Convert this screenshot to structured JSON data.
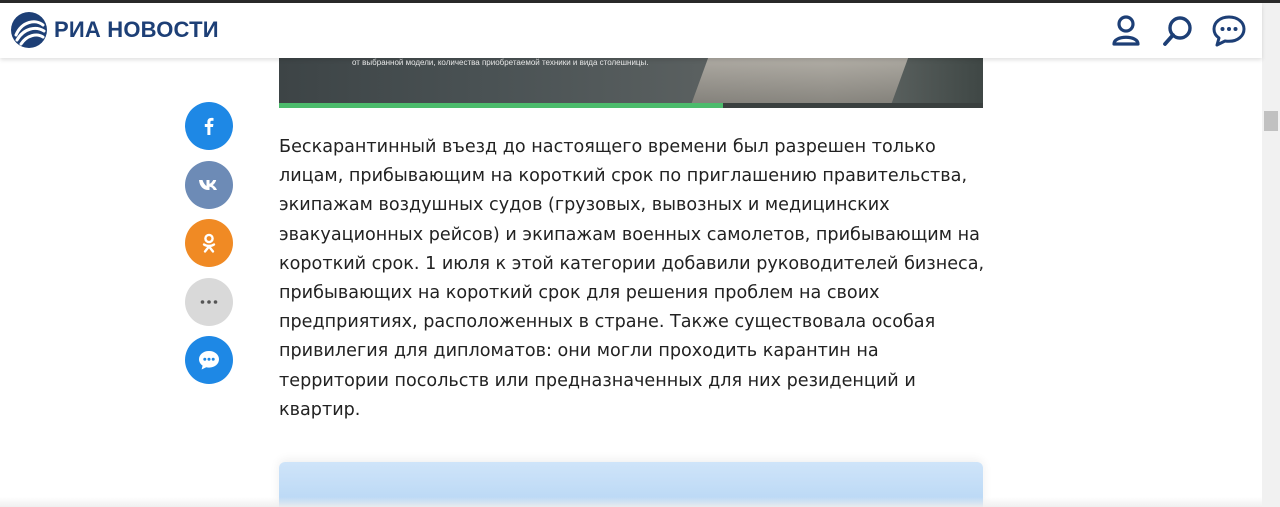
{
  "header": {
    "logo_text": "РИА НОВОСТИ",
    "icons": [
      "user-icon",
      "search-icon",
      "chat-icon"
    ],
    "brand_color": "#1d3f76"
  },
  "hero": {
    "caption": "от выбранной модели, количества приобретаемой техники и вида столешницы.",
    "progress_fraction": 0.63,
    "progress_color": "#4cbb6c"
  },
  "share": {
    "items": [
      "facebook-icon",
      "vk-icon",
      "odnoklassniki-icon",
      "more-icon",
      "comments-icon"
    ],
    "colors": {
      "facebook": "#1e88e5",
      "vk": "#6d8bb6",
      "odnoklassniki": "#f08a24",
      "more": "#d9d9d9",
      "comments": "#1e88e5"
    }
  },
  "article": {
    "lines": [
      "Бескарантинный въезд до настоящего времени был разрешен только",
      "лицам, прибывающим на короткий срок по приглашению правительства,",
      "экипажам воздушных судов (грузовых, вывозных и медицинских",
      "эвакуационных рейсов) и экипажам военных самолетов, прибывающим на",
      "короткий срок. 1 июля к этой категории добавили руководителей бизнеса,",
      "прибывающих на короткий срок для решения проблем на своих",
      "предприятиях, расположенных в стране. Также существовала особая",
      "привилегия для дипломатов: они могли проходить карантин на",
      "территории посольств или предназначенных для них резиденций и",
      "квартир."
    ]
  }
}
